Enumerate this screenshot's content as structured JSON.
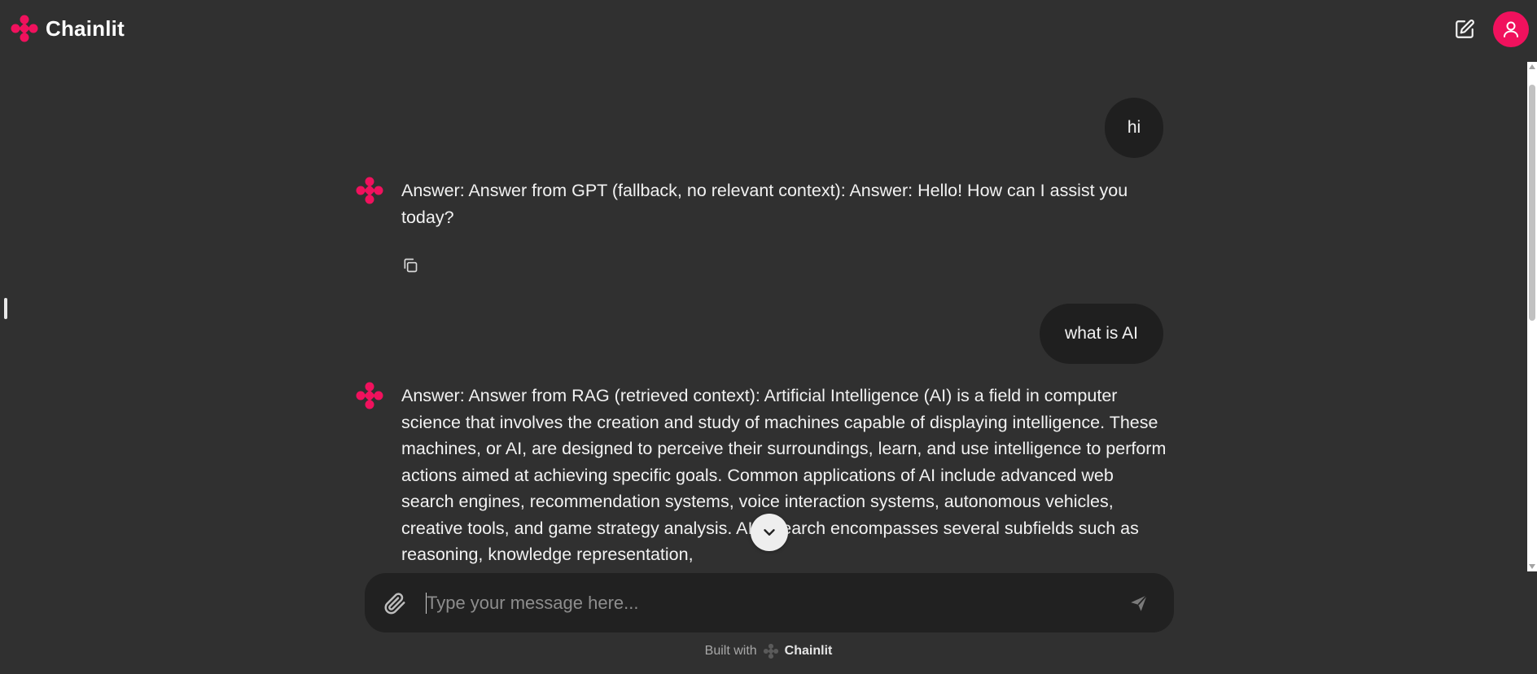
{
  "app": {
    "name": "Chainlit",
    "accent_color": "#f0115d",
    "background_color": "#303030"
  },
  "header": {
    "brand_name": "Chainlit",
    "logo_icon": "chainlit-logo-icon",
    "new_chat_icon": "edit-icon",
    "user_icon": "user-icon"
  },
  "messages": [
    {
      "role": "user",
      "text": "hi"
    },
    {
      "role": "assistant",
      "text": "Answer: Answer from GPT (fallback, no relevant context): Answer: Hello! How can I assist you today?",
      "action_icon": "copy-icon"
    },
    {
      "role": "user",
      "text": "what is AI"
    },
    {
      "role": "assistant",
      "text": "Answer: Answer from RAG (retrieved context): Artificial Intelligence (AI) is a field in computer science that involves the creation and study of machines capable of displaying intelligence. These machines, or AI, are designed to perceive their surroundings, learn, and use intelligence to perform actions aimed at achieving specific goals. Common applications of AI include advanced web search engines, recommendation systems, voice interaction systems, autonomous vehicles, creative tools, and game strategy analysis. AI research encompasses several subfields such as reasoning, knowledge representation,"
    }
  ],
  "composer": {
    "placeholder": "Type your message here...",
    "value": "",
    "attach_icon": "paperclip-icon",
    "send_icon": "send-icon"
  },
  "scroll_down_icon": "chevron-down-icon",
  "footer": {
    "built_with": "Built with",
    "brand": "Chainlit"
  }
}
